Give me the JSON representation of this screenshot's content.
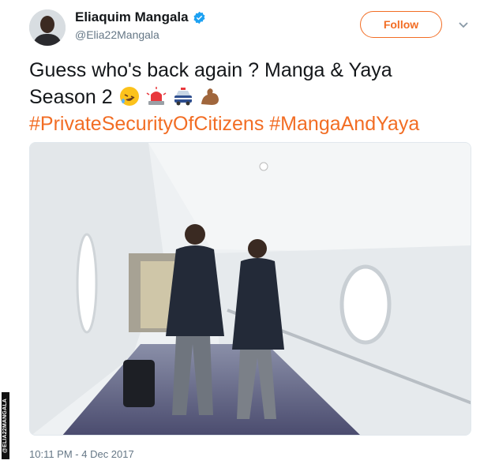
{
  "tweet": {
    "author": {
      "display_name": "Eliaquim Mangala",
      "handle": "@Elia22Mangala",
      "verified": true
    },
    "follow_label": "Follow",
    "text_line1": "Guess who's back again ? Manga & Yaya",
    "text_line2": "Season 2",
    "emojis": [
      "rolling-on-floor-laughing-icon",
      "police-light-icon",
      "police-car-icon",
      "flexed-biceps-icon"
    ],
    "hashtags": [
      "#PrivateSecurityOfCitizens",
      "#MangaAndYaya"
    ],
    "timestamp": "10:11 PM - 4 Dec 2017"
  },
  "photo_credit": "@ELIA22MANGALA",
  "colors": {
    "accent": "#f26d24",
    "verified": "#1da1f2",
    "muted": "#657786"
  }
}
